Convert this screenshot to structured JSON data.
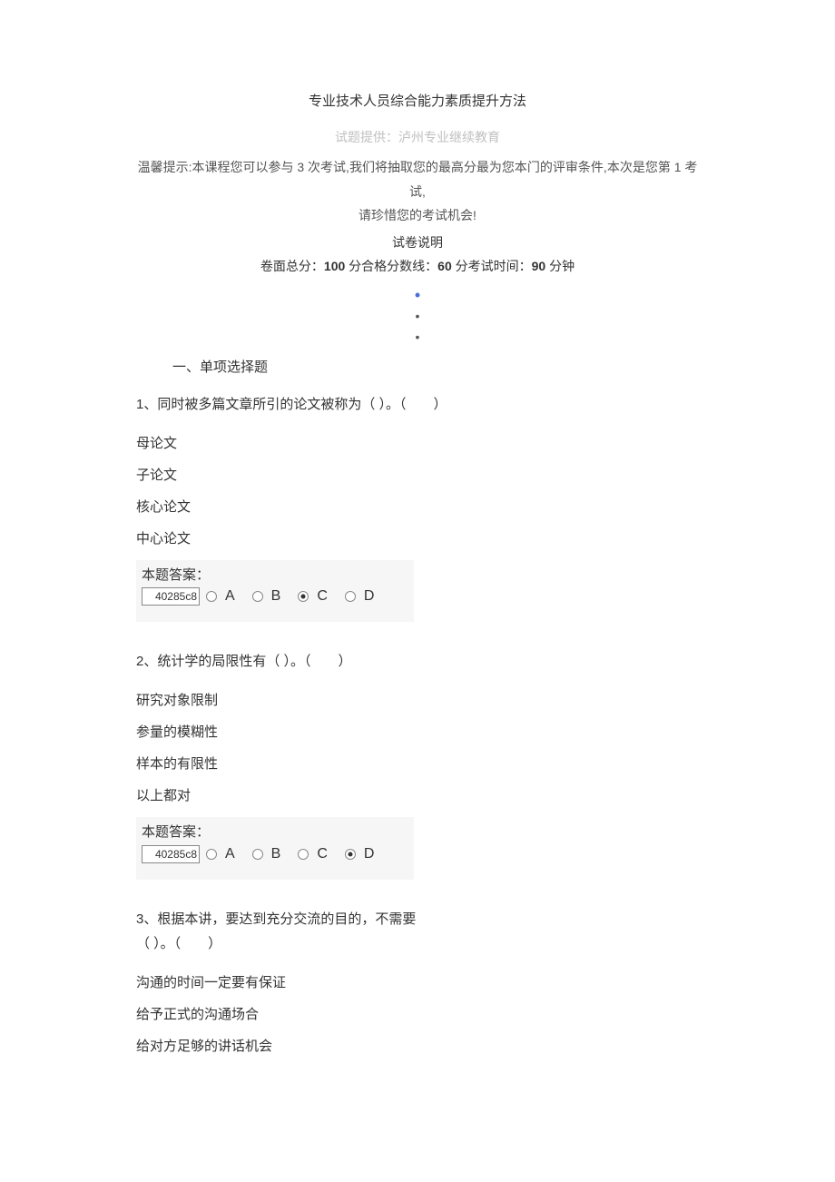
{
  "header": {
    "title": "专业技术人员综合能力素质提升方法",
    "provider": "试题提供：泸州专业继续教育",
    "tip_line1": "温馨提示:本课程您可以参与 3 次考试,我们将抽取您的最高分最为您本门的评审条件,本次是您第 1 考试,",
    "tip_line2": "请珍惜您的考试机会!",
    "exam_desc": "试卷说明",
    "score_prefix": "卷面总分：",
    "score_val": "100",
    "score_unit": " 分",
    "pass_prefix": "合格分数线：",
    "pass_val": "60",
    "pass_unit": " 分",
    "time_prefix": "考试时间：",
    "time_val": "90",
    "time_unit": " 分钟"
  },
  "section1_title": "一、单项选择题",
  "answer_label": "本题答案：",
  "code": "40285c8",
  "letters": {
    "a": "A",
    "b": "B",
    "c": "C",
    "d": "D"
  },
  "q1": {
    "text": "1、同时被多篇文章所引的论文被称为（ ）。（　　）",
    "opts": [
      "母论文",
      "子论文",
      "核心论文",
      "中心论文"
    ],
    "selected": 2
  },
  "q2": {
    "text": "2、统计学的局限性有（ ）。（　　）",
    "opts": [
      "研究对象限制",
      "参量的模糊性",
      "样本的有限性",
      "以上都对"
    ],
    "selected": 3
  },
  "q3": {
    "text_l1": "3、根据本讲，要达到充分交流的目的，不需要",
    "text_l2": "（ ）。（　　）",
    "opts": [
      "沟通的时间一定要有保证",
      "给予正式的沟通场合",
      "给对方足够的讲话机会"
    ]
  }
}
